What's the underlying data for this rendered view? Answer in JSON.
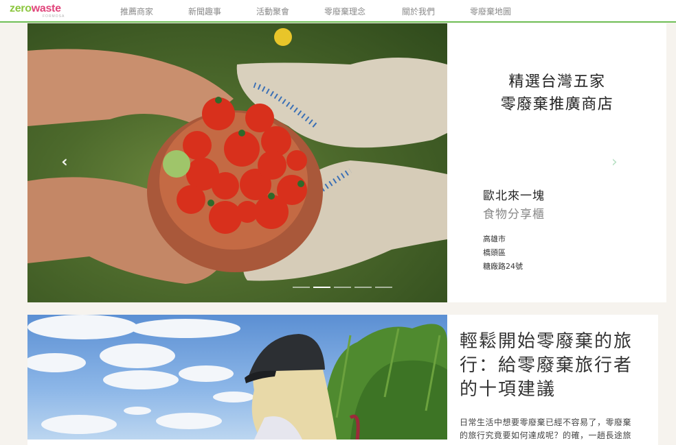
{
  "logo": {
    "part1": "zero",
    "part2": "waste",
    "sub": "FORMOSA"
  },
  "nav": [
    "推薦商家",
    "新聞趣事",
    "活動聚會",
    "零廢棄理念",
    "關於我們",
    "零廢棄地圖"
  ],
  "hero": {
    "title_lines": [
      "精選台灣五家",
      "零廢棄推廣商店"
    ],
    "store_name": "歐北來一塊",
    "store_subtitle": "食物分享櫃",
    "address": [
      "高雄市",
      "橋頭區",
      "糖廠路24號"
    ],
    "slide_count": 5,
    "active_slide": 2
  },
  "article": {
    "title_lines": [
      "輕鬆開始零廢棄的旅",
      "行：給零廢棄旅行者",
      "的十項建議"
    ],
    "excerpt_lines": [
      "日常生活中想要零廢棄已經不容易了，零廢棄",
      "的旅行究竟要如何達成呢？的確，一趟長途旅"
    ]
  },
  "colors": {
    "nav_underline": "#6fbf57",
    "logo_green": "#8cc63f",
    "logo_pink": "#e0457b"
  },
  "icons": {
    "prev": "chevron-left-icon",
    "next": "chevron-right-icon"
  }
}
